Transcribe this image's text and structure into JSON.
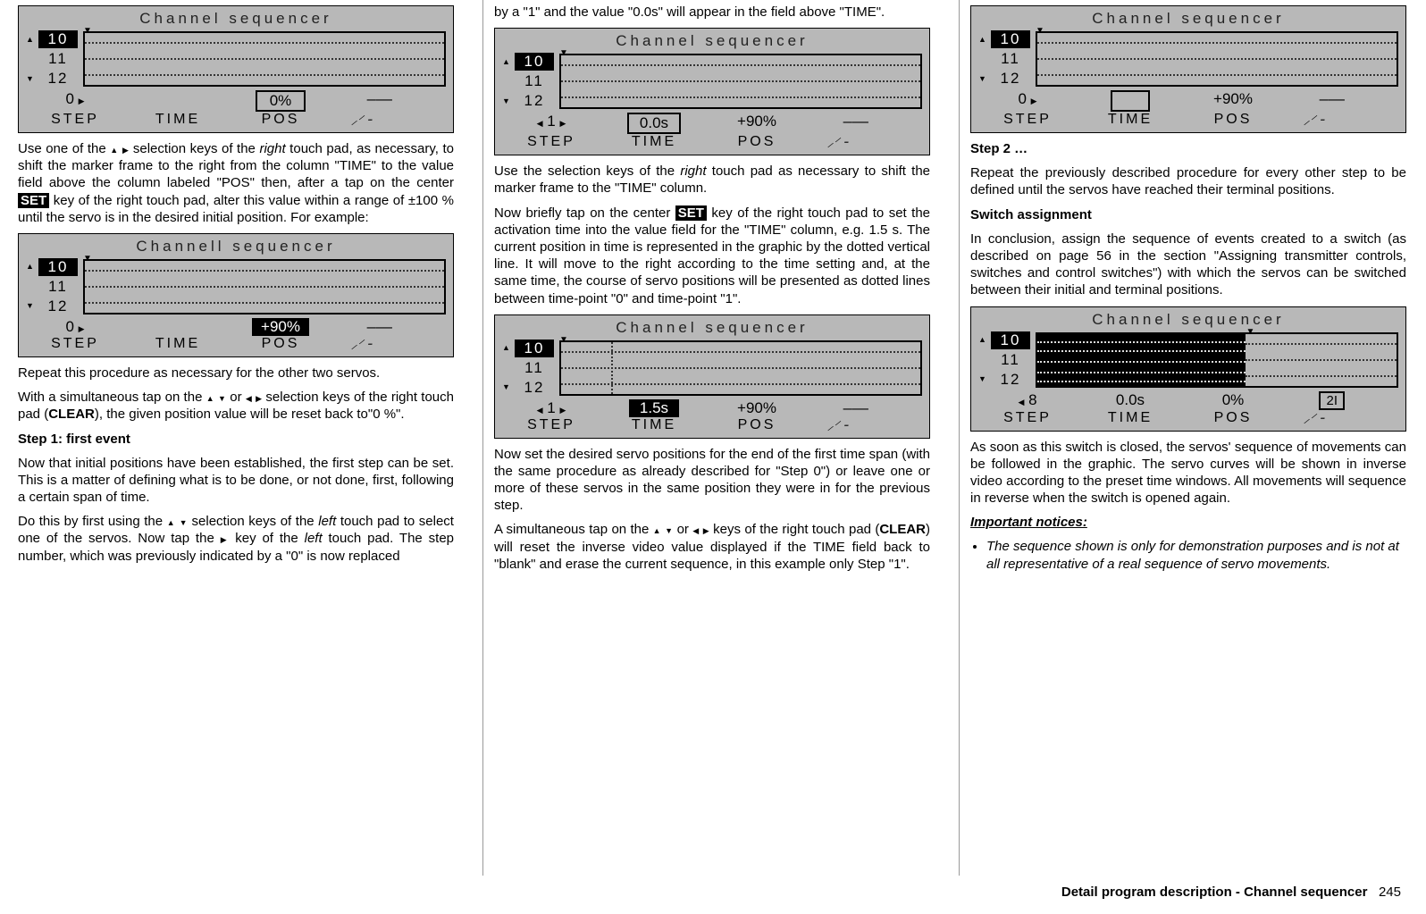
{
  "seq_title": "Channel  sequencer",
  "seq_title_alt": "Channell  sequencer",
  "list": {
    "a": "10",
    "b": "11",
    "c": "12"
  },
  "labels": {
    "step": "STEP",
    "time": "TIME",
    "pos": "POS"
  },
  "dashes": "–––",
  "switch": "⸝⸍╶",
  "s1": {
    "step": "0",
    "time": "",
    "pos_box": "0%"
  },
  "s2": {
    "step": "0",
    "time": "",
    "pos_inv": "+90%"
  },
  "s3": {
    "step": "1",
    "time_box": "0.0s",
    "pos": "+90%"
  },
  "s4": {
    "step": "1",
    "time_inv": "1.5s",
    "pos": "+90%"
  },
  "s5": {
    "step": "0",
    "time_box_empty": " ",
    "pos": "+90%"
  },
  "s6": {
    "step": "8",
    "time": "0.0s",
    "pos": "0%",
    "sw": "2I"
  },
  "c1": {
    "p0": "by a \"1\" and the value \"0.0s\" will appear in the field above \"TIME\".",
    "p1_a": "Use one of the ",
    "p1_b": " selection keys of the ",
    "p1_c": "right",
    "p1_d": " touch pad, as necessary, to shift the marker frame to the right from the column \"TIME\" to the value field above the column labeled \"POS\" then, after a tap on the center ",
    "p1_set": "SET",
    "p1_e": " key of the right touch pad, alter this value within a range of ±100 % until the servo is in the desired initial position. For example:",
    "p2": "Repeat this procedure as necessary for the other two servos.",
    "p3_a": "With a simultaneous tap on the ",
    "p3_b": " or ",
    "p3_c": " selection keys of the right touch pad (",
    "p3_clear": "CLEAR",
    "p3_d": "), the given position value will be reset back to\"0 %\".",
    "h1": "Step 1: first event",
    "p4": "Now that initial positions have been established, the first step can be set. This is a matter of defining what is to be done, or not done, first, following a certain span of time.",
    "p5_a": "Do this by first using the ",
    "p5_b": " selection keys of the ",
    "p5_c": "left",
    "p5_d": " touch pad to select one of the servos. Now tap the ",
    "p5_e": " key of the ",
    "p5_f": "left",
    "p5_g": " touch pad. The step number, which was previously indicated by a \"0\" is now replaced"
  },
  "c2": {
    "p1_a": "Use the selection keys of the ",
    "p1_b": "right",
    "p1_c": " touch pad as necessary to shift the marker frame to the \"TIME\" column.",
    "p2_a": "Now briefly tap on the center ",
    "p2_set": "SET",
    "p2_b": " key of the right touch pad to set the activation time into the value field for the \"TIME\" column, e.g. 1.5 s. The current position in time is represented in the graphic by the dotted vertical line. It will move to the right according to the time setting and, at the same time, the course of servo positions will be presented as dotted lines between time-point \"0\" and time-point \"1\".",
    "p3": "Now set the desired servo positions for the end of the first time span (with the same procedure as already described for \"Step 0\") or leave one or more of these servos in the same position they were in for the previous step.",
    "p4_a": "A simultaneous tap on the ",
    "p4_b": " or ",
    "p4_c": " keys of the right touch pad (",
    "p4_clear": "CLEAR",
    "p4_d": ") will reset the inverse video value displayed if the TIME field back to \"blank\" and erase the current sequence, in this example only Step \"1\"."
  },
  "c3": {
    "h1": "Step 2 …",
    "p1": "Repeat the previously described procedure for every other step to be defined until the servos have reached their terminal positions.",
    "h2": "Switch assignment",
    "p2": "In conclusion, assign the sequence of events created to a switch (as described on page 56 in the section \"Assigning transmitter controls, switches and control switches\") with which the servos can be switched between their initial and terminal positions.",
    "p3": "As soon as this switch is closed, the servos' sequence of movements can be followed in the graphic. The servo curves will be shown in inverse video according to the preset time windows. All movements will sequence in reverse when the switch is opened again.",
    "h3": "Important notices:",
    "li1": "The sequence shown is only for demonstration purposes and is not at all representative of a real sequence of servo movements."
  },
  "footer": {
    "label": "Detail program description - Channel sequencer",
    "page": "245"
  }
}
